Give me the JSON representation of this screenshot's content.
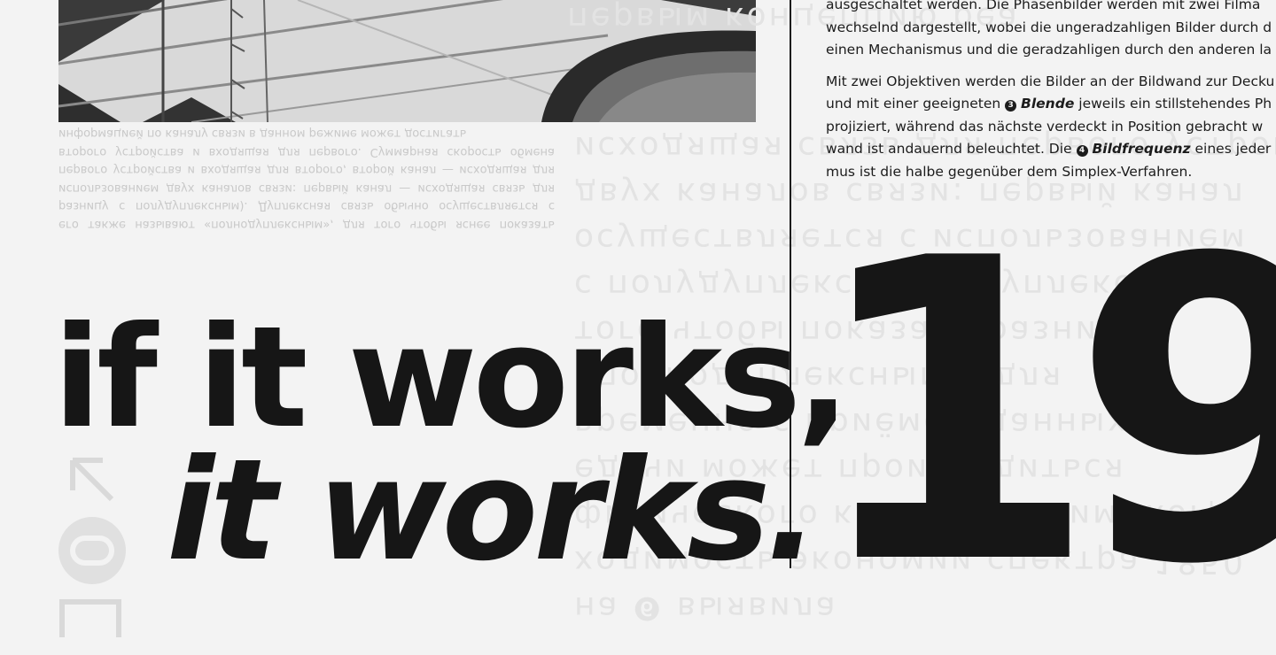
{
  "german_text": {
    "line1": "ausgeschaltet werden. Die Phasenbilder werden mit zwei Filma",
    "line2": "wechselnd dargestellt, wobei die ungeradzahligen Bilder durch d",
    "line3": "einen Mechanismus und die geradzahligen durch den anderen la",
    "para2_line1": "Mit zwei Objektiven werden die Bilder an der Bildwand zur Decku",
    "para2_line2_pre": "und mit einer geeigneten ",
    "marker1": "3",
    "term1": "Blende",
    "para2_line2_post": " jeweils ein stillstehendes Ph",
    "para2_line3": "projiziert, während das nächste verdeckt in Position gebracht w",
    "para2_line4_pre": "wand ist andauernd beleuchtet. Die ",
    "marker2": "4",
    "term2": "Bildfrequenz",
    "para2_line4_post": " eines jeder",
    "para2_line5": "mus ist die halbe gegenüber dem Simplex-Verfahren."
  },
  "background_small_text": "его также называют «полнодуплексным», для того чтобы яснее показать разницу с полудуплексным). Дуплексная связь обычно осуществляется с использованием двух каналов связи: первый канал — исходящая связь для первого устройства и входящая для второго, второй канал — исходящая для второго устройства и входящая для первого. Суммарная скорость обмена информацией по каналу связи в данном режиме может достигать",
  "background_display_lines": [
    "первым концепцию реа",
    "на ❻ выявила",
    "ходимость экономии спектра 1850",
    "физического канала. Режим, когда",
    "едачи может производиться",
    "временно с приёмом данных (иногда",
    "«полнодуплексным», для",
    "того чтобы показать разницу",
    "с полудуплексным). Дуплексная связь",
    "осуществляется с использованием",
    "двух каналов связи: первый канал",
    "исходящая связь для первого устройства"
  ],
  "headline": {
    "line1": "if it works,",
    "line2": "it works."
  },
  "big_number": "19",
  "colors": {
    "background": "#f3f3f3",
    "ink": "#161616",
    "ghost_text": "#c9c9c9",
    "ghost_display": "#e3e3e3"
  },
  "icons": [
    "arrow-up-left-icon",
    "rounded-square-circle-icon",
    "square-outline-icon"
  ]
}
